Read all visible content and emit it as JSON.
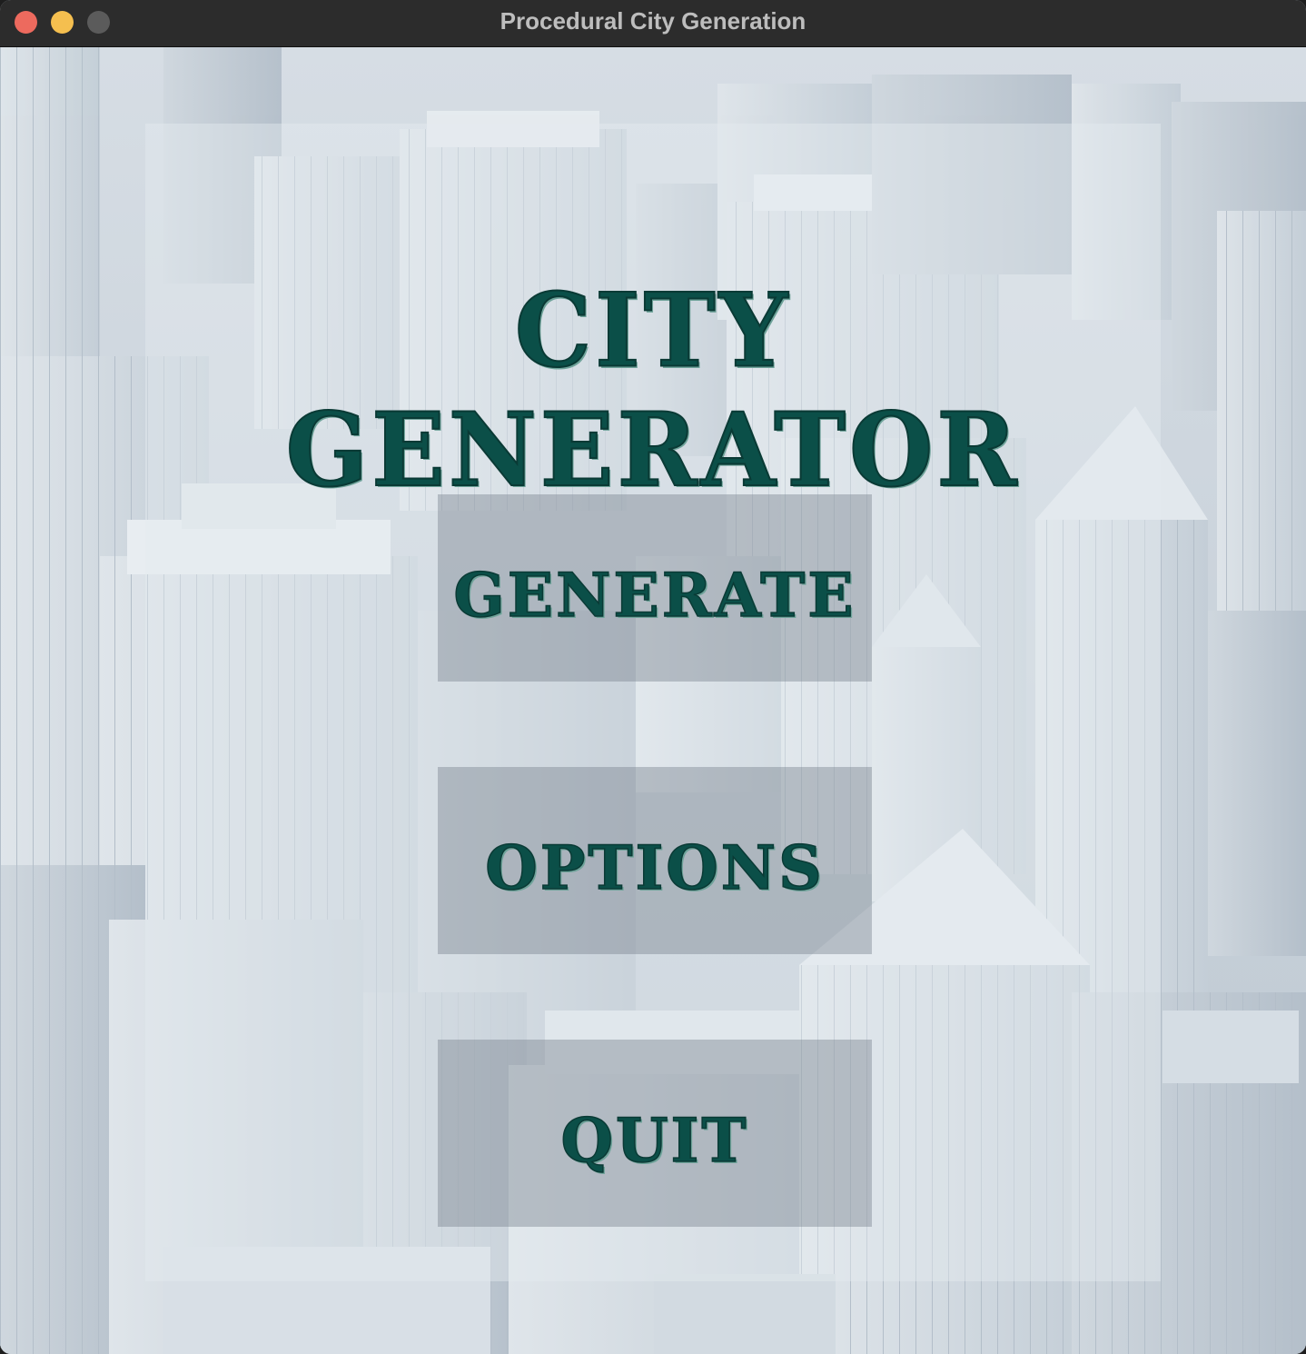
{
  "window": {
    "title": "Procedural City Generation",
    "controls": {
      "close_color": "#ed6a5e",
      "minimize_color": "#f5bf4f",
      "zoom_color": "#5b5b5b"
    }
  },
  "menu": {
    "title": "CITY GENERATOR",
    "buttons": {
      "generate": "GENERATE",
      "options": "OPTIONS",
      "quit": "QUIT"
    }
  },
  "theme": {
    "text_color": "#0b4f48",
    "background": "aerial view of white city skyscrapers"
  }
}
